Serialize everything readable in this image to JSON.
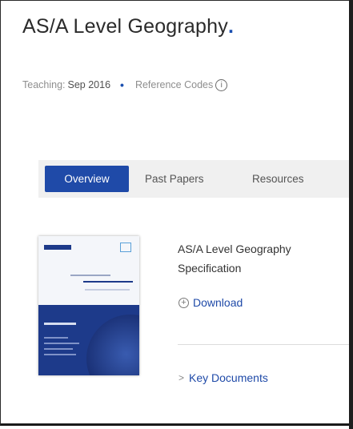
{
  "header": {
    "title": "AS/A Level Geography",
    "title_dot": "."
  },
  "meta": {
    "teaching_label": "Teaching:",
    "teaching_value": "Sep 2016",
    "separator": "•",
    "reference_codes_label": "Reference Codes",
    "info_icon": "info-icon",
    "info_glyph": "i"
  },
  "tabs": [
    {
      "label": "Overview",
      "active": true
    },
    {
      "label": "Past Papers",
      "active": false
    },
    {
      "label": "Resources",
      "active": false
    }
  ],
  "document": {
    "title": "AS/A Level Geography Specification",
    "download_label": "Download",
    "download_icon": "plus-circle-icon",
    "download_glyph": "+",
    "key_documents_label": "Key Documents",
    "key_documents_icon": "chevron-right-icon",
    "key_documents_glyph": ">"
  },
  "colors": {
    "accent": "#1f4aa8",
    "tab_bar_bg": "#f0f0f0",
    "title_text": "#2b2b2b",
    "meta_text": "#8e8e8e"
  }
}
